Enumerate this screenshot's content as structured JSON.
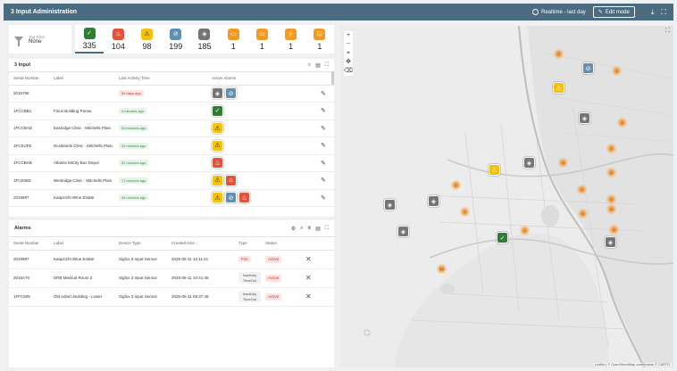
{
  "topbar": {
    "title": "3 Input Administration",
    "realtime_label": "Realtime - last day",
    "edit_label": "Edit mode"
  },
  "filter": {
    "label": "Tag Filter",
    "value": "None"
  },
  "kpis": [
    {
      "icon": "check-icon",
      "color": "#2e7d32",
      "value": "335",
      "glyph": "✓"
    },
    {
      "icon": "fire-icon",
      "color": "#e2533b",
      "value": "104",
      "glyph": "♨"
    },
    {
      "icon": "warning-icon",
      "color": "#f4c20d",
      "value": "98",
      "glyph": "⚠"
    },
    {
      "icon": "compass-icon",
      "color": "#5f8fb3",
      "value": "199",
      "glyph": "⊘"
    },
    {
      "icon": "signal-icon",
      "color": "#757575",
      "value": "185",
      "glyph": "◈"
    },
    {
      "icon": "battery-low-icon",
      "color": "#f39a26",
      "value": "1",
      "glyph": "▭"
    },
    {
      "icon": "battery-icon",
      "color": "#f39a26",
      "value": "1",
      "glyph": "▭"
    },
    {
      "icon": "plug-icon",
      "color": "#f39a26",
      "value": "1",
      "glyph": "⚡"
    },
    {
      "icon": "lock-icon",
      "color": "#f39a26",
      "value": "1",
      "glyph": "⊡"
    }
  ],
  "input_panel": {
    "title": "3 Input",
    "columns": [
      "Serial Number",
      "Label",
      "Last Activity Time",
      "Active Alarms"
    ],
    "rows": [
      {
        "serial": "2016798",
        "label": "",
        "time": "54 days ago",
        "time_status": "red",
        "alarms": [
          "signal-icon",
          "compass-icon"
        ]
      },
      {
        "serial": "1FCCBB1",
        "label": "Finus Building Parow",
        "time": "4 minutes ago",
        "time_status": "green",
        "alarms": [
          "check-icon"
        ]
      },
      {
        "serial": "1FCCBAD",
        "label": "Eastridge Clinic - Mitchells Plain",
        "time": "53 minutes ago",
        "time_status": "green",
        "alarms": [
          "warning-icon"
        ]
      },
      {
        "serial": "1FCEUFE",
        "label": "Rocklands Clinic - Mitchells Plain",
        "time": "24 minutes ago",
        "time_status": "green",
        "alarms": [
          "warning-icon"
        ]
      },
      {
        "serial": "1FCCBAB",
        "label": "Atlantis MiCity Bus Depot",
        "time": "51 minutes ago",
        "time_status": "green",
        "alarms": [
          "fire-icon"
        ]
      },
      {
        "serial": "1FCE05D",
        "label": "Westridge Clinic - Mitchells Plain",
        "time": "17 minutes ago",
        "time_status": "green",
        "alarms": [
          "warning-icon",
          "fire-icon"
        ]
      },
      {
        "serial": "2016997",
        "label": "Kaapzicht Wine Estate",
        "time": "34 minutes ago",
        "time_status": "green",
        "alarms": [
          "warning-icon",
          "compass-icon",
          "fire-icon"
        ]
      }
    ]
  },
  "alarms_panel": {
    "title": "Alarms",
    "columns": [
      "Serial Number",
      "Label",
      "Device Type",
      "Created time ↓",
      "Type",
      "Status"
    ],
    "rows": [
      {
        "serial": "2016997",
        "label": "Kaapzicht Wine Estate",
        "device": "Sigfox 3 Input Sensor",
        "created": "2025-06-11 12:11:21",
        "type": "Fire",
        "status": "Active"
      },
      {
        "serial": "2016A70",
        "label": "DRB Medical Room 2",
        "device": "Sigfox 3 Input Sensor",
        "created": "2025-06-11 10:41:46",
        "type": "Inactivity TimeOut",
        "status": "Active"
      },
      {
        "serial": "1FFC509",
        "label": "Old Admin Building - Lower",
        "device": "Sigfox 3 Input Sensor",
        "created": "2025-06-11 09:37:46",
        "type": "Inactivity TimeOut",
        "status": "Active"
      }
    ]
  },
  "map": {
    "attribution": "Leaflet | © OpenStreetMap contributors © CARTO",
    "markers": [
      {
        "kind": "compass-icon",
        "color": "#5f8fb3"
      },
      {
        "kind": "warning-icon",
        "color": "#f4c20d"
      },
      {
        "kind": "signal-icon",
        "color": "#757575"
      },
      {
        "kind": "warning-icon",
        "color": "#f4c20d"
      },
      {
        "kind": "signal-icon",
        "color": "#757575"
      },
      {
        "kind": "signal-icon",
        "color": "#757575"
      },
      {
        "kind": "signal-icon",
        "color": "#757575"
      },
      {
        "kind": "signal-icon",
        "color": "#757575"
      },
      {
        "kind": "check-icon",
        "color": "#2e7d32"
      },
      {
        "kind": "signal-icon",
        "color": "#757575"
      }
    ],
    "clusters": [
      "2",
      "4",
      "3",
      "2",
      "3",
      "4",
      "2",
      "3",
      "3",
      "4",
      "6",
      "2",
      "3",
      "4",
      "14"
    ]
  }
}
